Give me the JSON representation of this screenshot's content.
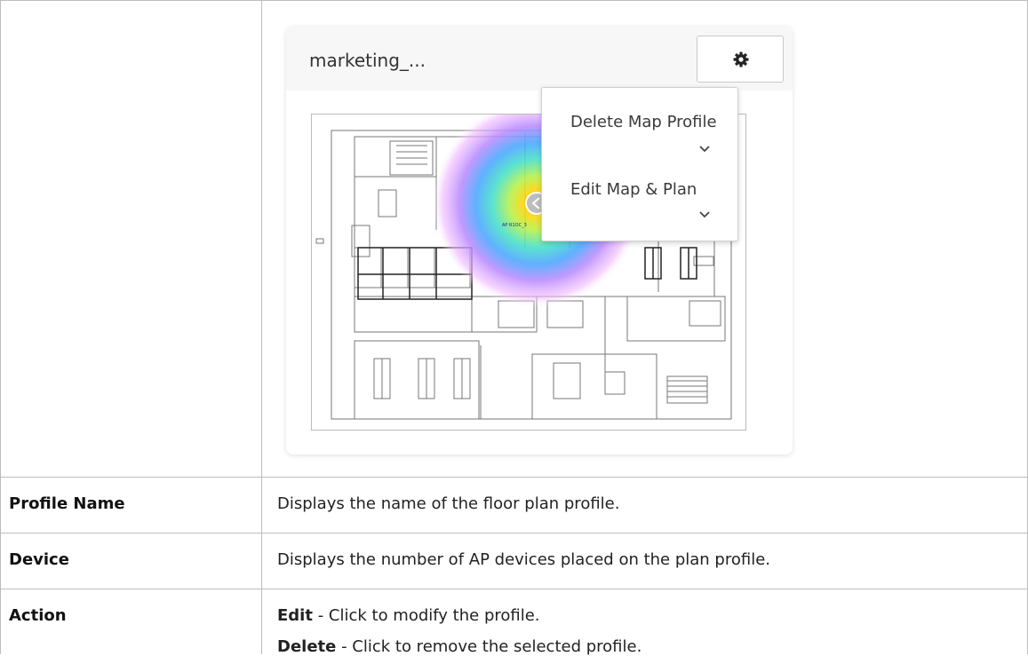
{
  "card": {
    "title": "marketing_...",
    "menu": {
      "items": [
        {
          "label": "Delete Map Profile"
        },
        {
          "label": "Edit Map & Plan"
        }
      ]
    },
    "map": {
      "ap_label": "AP R1OC_3"
    }
  },
  "rows": [
    {
      "label": "Profile Name",
      "description": "Displays the name of the floor plan profile."
    },
    {
      "label": "Device",
      "description": "Displays the number of AP devices placed on the plan profile."
    },
    {
      "label": "Action",
      "items": [
        {
          "term": "Edit",
          "text": " - Click to modify the profile."
        },
        {
          "term": "Delete",
          "text": " - Click to remove the selected profile."
        }
      ]
    }
  ]
}
